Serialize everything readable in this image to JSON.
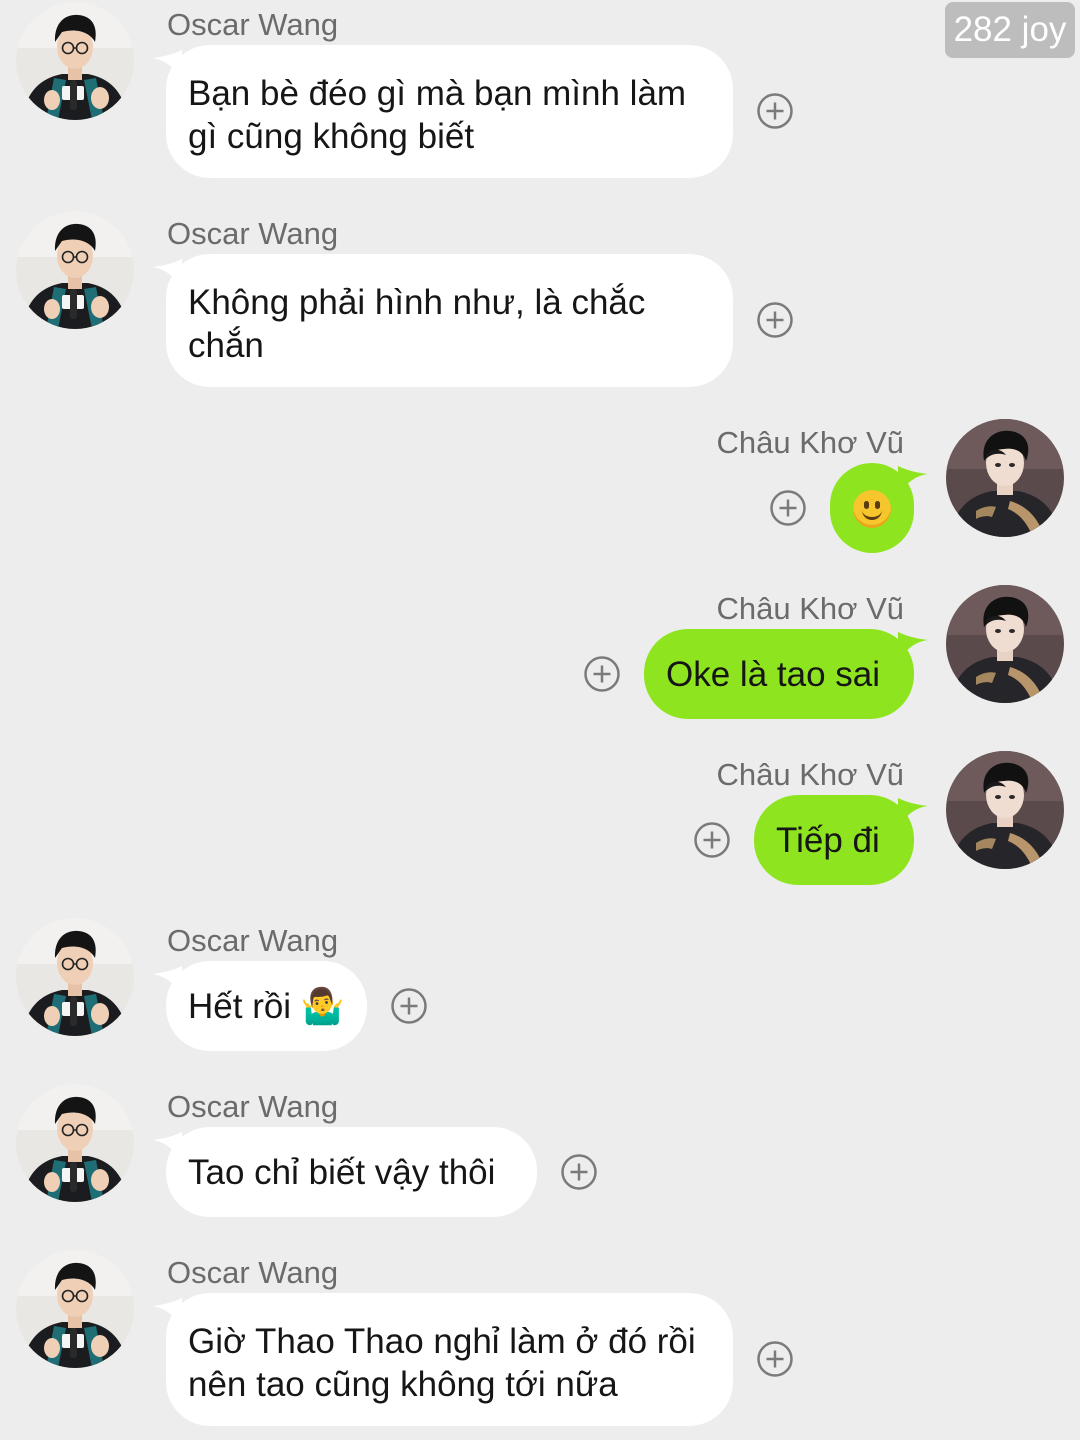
{
  "badge": {
    "text": "282 joy"
  },
  "colors": {
    "background": "#ededed",
    "incoming_bubble": "#ffffff",
    "outgoing_bubble": "#8ee51f",
    "sender_name": "#6b6b6b"
  },
  "icons": {
    "react_button": "plus-circle-icon",
    "smile_emoji": "smiling-face-icon",
    "shrug_emoji": "person-shrugging-icon"
  },
  "messages": [
    {
      "sender": "Oscar Wang",
      "direction": "incoming",
      "text": "Bạn bè đéo gì mà bạn mình làm\ngì cũng không biết"
    },
    {
      "sender": "Oscar Wang",
      "direction": "incoming",
      "text": "Không phải hình như, là chắc\nchắn"
    },
    {
      "sender": "Châu Khơ Vũ",
      "direction": "outgoing",
      "text": "🙂"
    },
    {
      "sender": "Châu Khơ Vũ",
      "direction": "outgoing",
      "text": "Oke là tao sai"
    },
    {
      "sender": "Châu Khơ Vũ",
      "direction": "outgoing",
      "text": "Tiếp đi"
    },
    {
      "sender": "Oscar Wang",
      "direction": "incoming",
      "text": "Hết rồi 🤷‍♂️"
    },
    {
      "sender": "Oscar Wang",
      "direction": "incoming",
      "text": "Tao chỉ biết vậy thôi"
    },
    {
      "sender": "Oscar Wang",
      "direction": "incoming",
      "text": "Giờ Thao Thao nghỉ làm ở đó rồi\nnên tao cũng không tới nữa"
    }
  ]
}
